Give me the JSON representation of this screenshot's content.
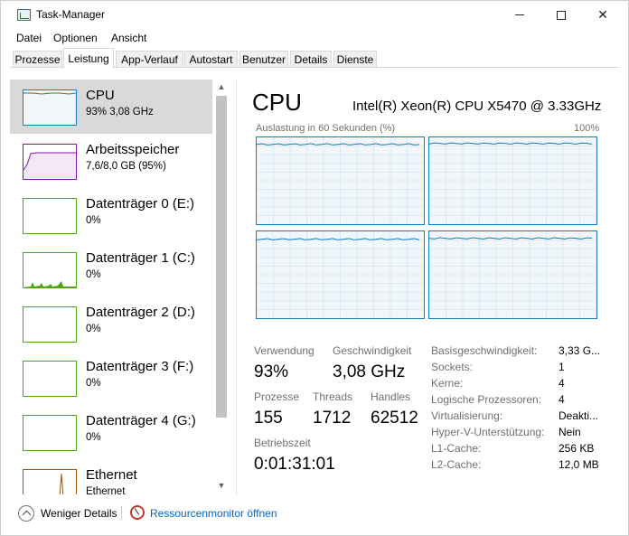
{
  "window": {
    "title": "Task-Manager",
    "icons": {
      "app": "task-manager-icon",
      "minimize": "minimize-icon",
      "maximize": "maximize-icon",
      "close": "close-icon"
    }
  },
  "menu": [
    "Datei",
    "Optionen",
    "Ansicht"
  ],
  "tabs": [
    "Prozesse",
    "Leistung",
    "App-Verlauf",
    "Autostart",
    "Benutzer",
    "Details",
    "Dienste"
  ],
  "active_tab": "Leistung",
  "perf_list": [
    {
      "title": "CPU",
      "subtitle": "93% 3,08 GHz",
      "color": "#117dbb"
    },
    {
      "title": "Arbeitsspeicher",
      "subtitle": "7,6/8,0 GB (95%)",
      "color": "#8b12ae"
    },
    {
      "title": "Datenträger 0 (E:)",
      "subtitle": "0%",
      "color": "#4da60c"
    },
    {
      "title": "Datenträger 1 (C:)",
      "subtitle": "0%",
      "color": "#4da60c"
    },
    {
      "title": "Datenträger 2 (D:)",
      "subtitle": "0%",
      "color": "#4da60c"
    },
    {
      "title": "Datenträger 3 (F:)",
      "subtitle": "0%",
      "color": "#4da60c"
    },
    {
      "title": "Datenträger 4 (G:)",
      "subtitle": "0%",
      "color": "#4da60c"
    },
    {
      "title": "Ethernet",
      "subtitle": "Ethernet",
      "color": "#a74f01"
    }
  ],
  "cpu": {
    "title": "CPU",
    "model": "Intel(R) Xeon(R) CPU X5470 @ 3.33GHz",
    "graph_label": "Auslastung in 60 Sekunden (%)",
    "graph_max": "100%",
    "core_levels_percent": [
      92,
      93,
      91,
      92
    ],
    "stats": {
      "usage_label": "Verwendung",
      "usage_value": "93%",
      "speed_label": "Geschwindigkeit",
      "speed_value": "3,08 GHz",
      "processes_label": "Prozesse",
      "processes_value": "155",
      "threads_label": "Threads",
      "threads_value": "1712",
      "handles_label": "Handles",
      "handles_value": "62512",
      "uptime_label": "Betriebszeit",
      "uptime_value": "0:01:31:01"
    },
    "properties": [
      {
        "key": "Basisgeschwindigkeit:",
        "value": "3,33 G..."
      },
      {
        "key": "Sockets:",
        "value": "1"
      },
      {
        "key": "Kerne:",
        "value": "4"
      },
      {
        "key": "Logische Prozessoren:",
        "value": "4"
      },
      {
        "key": "Virtualisierung:",
        "value": "Deakti..."
      },
      {
        "key": "Hyper-V-Unterstützung:",
        "value": "Nein"
      },
      {
        "key": "L1-Cache:",
        "value": "256 KB"
      },
      {
        "key": "L2-Cache:",
        "value": "12,0 MB"
      }
    ]
  },
  "footer": {
    "fewer_details": "Weniger Details",
    "resource_monitor": "Ressourcenmonitor öffnen"
  },
  "colors": {
    "cpu": "#117dbb",
    "memory": "#8b12ae",
    "disk": "#4da60c",
    "ethernet": "#a74f01",
    "link": "#0066cc"
  }
}
